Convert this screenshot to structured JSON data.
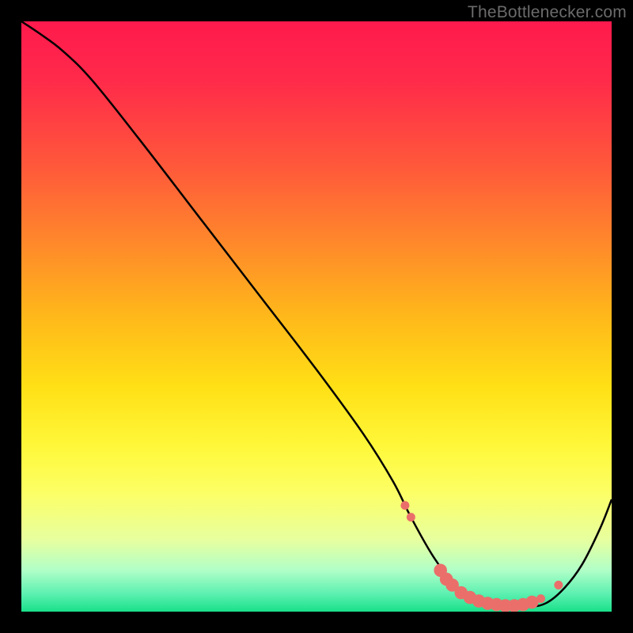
{
  "watermark": "TheBottlenecker.com",
  "chart_data": {
    "type": "line",
    "title": "",
    "xlabel": "",
    "ylabel": "",
    "xlim": [
      0,
      100
    ],
    "ylim": [
      0,
      100
    ],
    "curve": {
      "x": [
        0,
        3,
        7,
        12,
        20,
        30,
        40,
        50,
        58,
        63,
        66,
        70,
        74,
        78,
        82,
        86,
        89,
        92,
        95,
        98,
        100
      ],
      "y": [
        100,
        98,
        95,
        90,
        80,
        67,
        54,
        41,
        30,
        22,
        16,
        9,
        4,
        1.5,
        0.8,
        0.8,
        1.5,
        4,
        8,
        14,
        19
      ]
    },
    "highlight_points": {
      "x": [
        65,
        66,
        71,
        72,
        73,
        74.5,
        76,
        77.5,
        79,
        80.5,
        82,
        83.5,
        85,
        86.5,
        88,
        91
      ],
      "y": [
        18,
        16,
        7,
        5.5,
        4.5,
        3.2,
        2.4,
        1.8,
        1.4,
        1.2,
        1.0,
        1.0,
        1.2,
        1.6,
        2.2,
        4.5
      ]
    },
    "highlight_style": {
      "color": "#ea6f6a",
      "radius_range": [
        5.5,
        9
      ]
    }
  }
}
